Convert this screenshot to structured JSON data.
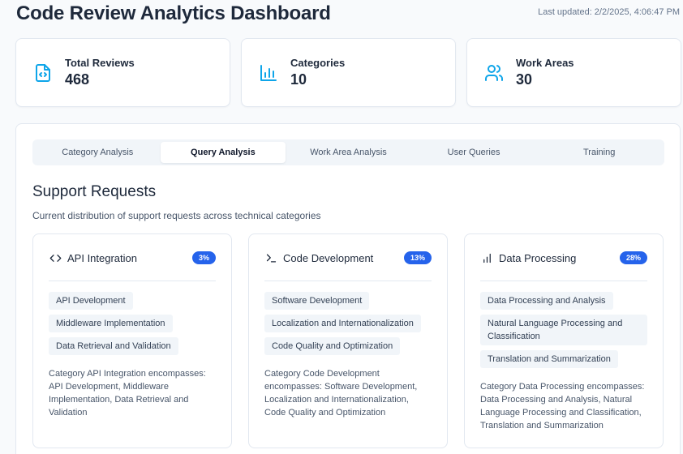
{
  "header": {
    "title": "Code Review Analytics Dashboard",
    "last_updated": "Last updated: 2/2/2025, 4:06:47 PM"
  },
  "stats": [
    {
      "label": "Total Reviews",
      "value": "468",
      "icon": "file-code-icon"
    },
    {
      "label": "Categories",
      "value": "10",
      "icon": "bar-chart-icon"
    },
    {
      "label": "Work Areas",
      "value": "30",
      "icon": "users-icon"
    }
  ],
  "tabs": [
    {
      "label": "Category Analysis",
      "active": false
    },
    {
      "label": "Query Analysis",
      "active": true
    },
    {
      "label": "Work Area Analysis",
      "active": false
    },
    {
      "label": "User Queries",
      "active": false
    },
    {
      "label": "Training",
      "active": false
    }
  ],
  "section": {
    "title": "Support Requests",
    "subtitle": "Current distribution of support requests across technical categories"
  },
  "categories": [
    {
      "name": "API Integration",
      "icon": "code-icon",
      "percent": "3%",
      "tags": [
        "API Development",
        "Middleware Implementation",
        "Data Retrieval and Validation"
      ],
      "description": "Category API Integration encompasses: API Development, Middleware Implementation, Data Retrieval and Validation"
    },
    {
      "name": "Code Development",
      "icon": "terminal-icon",
      "percent": "13%",
      "tags": [
        "Software Development",
        "Localization and Internationalization",
        "Code Quality and Optimization"
      ],
      "description": "Category Code Development encompasses: Software Development, Localization and Internationalization, Code Quality and Optimization"
    },
    {
      "name": "Data Processing",
      "icon": "bar-chart-icon",
      "percent": "28%",
      "tags": [
        "Data Processing and Analysis",
        "Natural Language Processing and Classification",
        "Translation and Summarization"
      ],
      "description": "Category Data Processing encompasses: Data Processing and Analysis, Natural Language Processing and Classification, Translation and Summarization"
    }
  ],
  "colors": {
    "accent": "#2563eb",
    "icon_accent": "#0ea5e9",
    "background": "#f8fafc"
  }
}
